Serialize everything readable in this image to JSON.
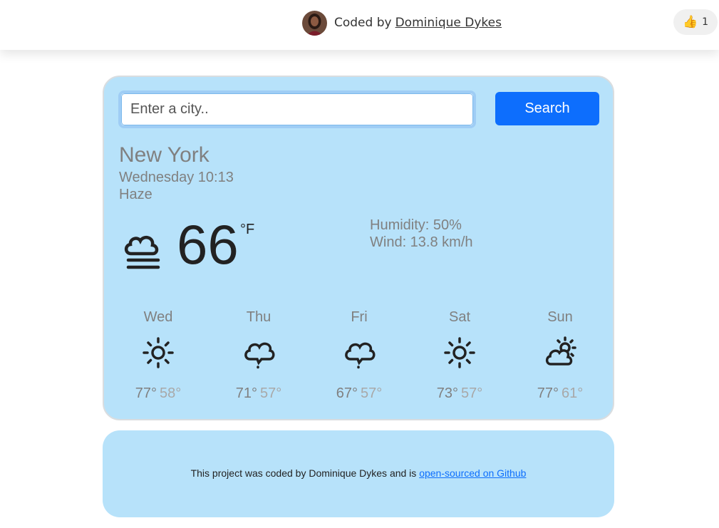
{
  "header": {
    "credit_prefix": "Coded by",
    "author_link": "Dominique Dykes",
    "like_count": "1",
    "avatar_icon": "avatar-photo",
    "like_icon": "thumbs-up-icon"
  },
  "search": {
    "placeholder": "Enter a city..",
    "value": "",
    "button_label": "Search"
  },
  "current": {
    "city": "New York",
    "datetime": "Wednesday 10:13",
    "description": "Haze",
    "icon": "haze-icon",
    "temperature": "66",
    "unit": "°F",
    "humidity": "Humidity: 50%",
    "wind": "Wind: 13.8 km/h"
  },
  "forecast": [
    {
      "day": "Wed",
      "icon": "sun-icon",
      "max": "77°",
      "min": "58°"
    },
    {
      "day": "Thu",
      "icon": "rain-cloud-icon",
      "max": "71°",
      "min": "57°"
    },
    {
      "day": "Fri",
      "icon": "rain-cloud-icon",
      "max": "67°",
      "min": "57°"
    },
    {
      "day": "Sat",
      "icon": "sun-icon",
      "max": "73°",
      "min": "57°"
    },
    {
      "day": "Sun",
      "icon": "partly-cloudy-icon",
      "max": "77°",
      "min": "61°"
    }
  ],
  "footer": {
    "text": "This project was coded by Dominique Dykes and is",
    "link": "open-sourced on Github"
  },
  "colors": {
    "card_background": "#b7e2fa",
    "button": "#0d6efd",
    "muted_text": "#808080"
  }
}
